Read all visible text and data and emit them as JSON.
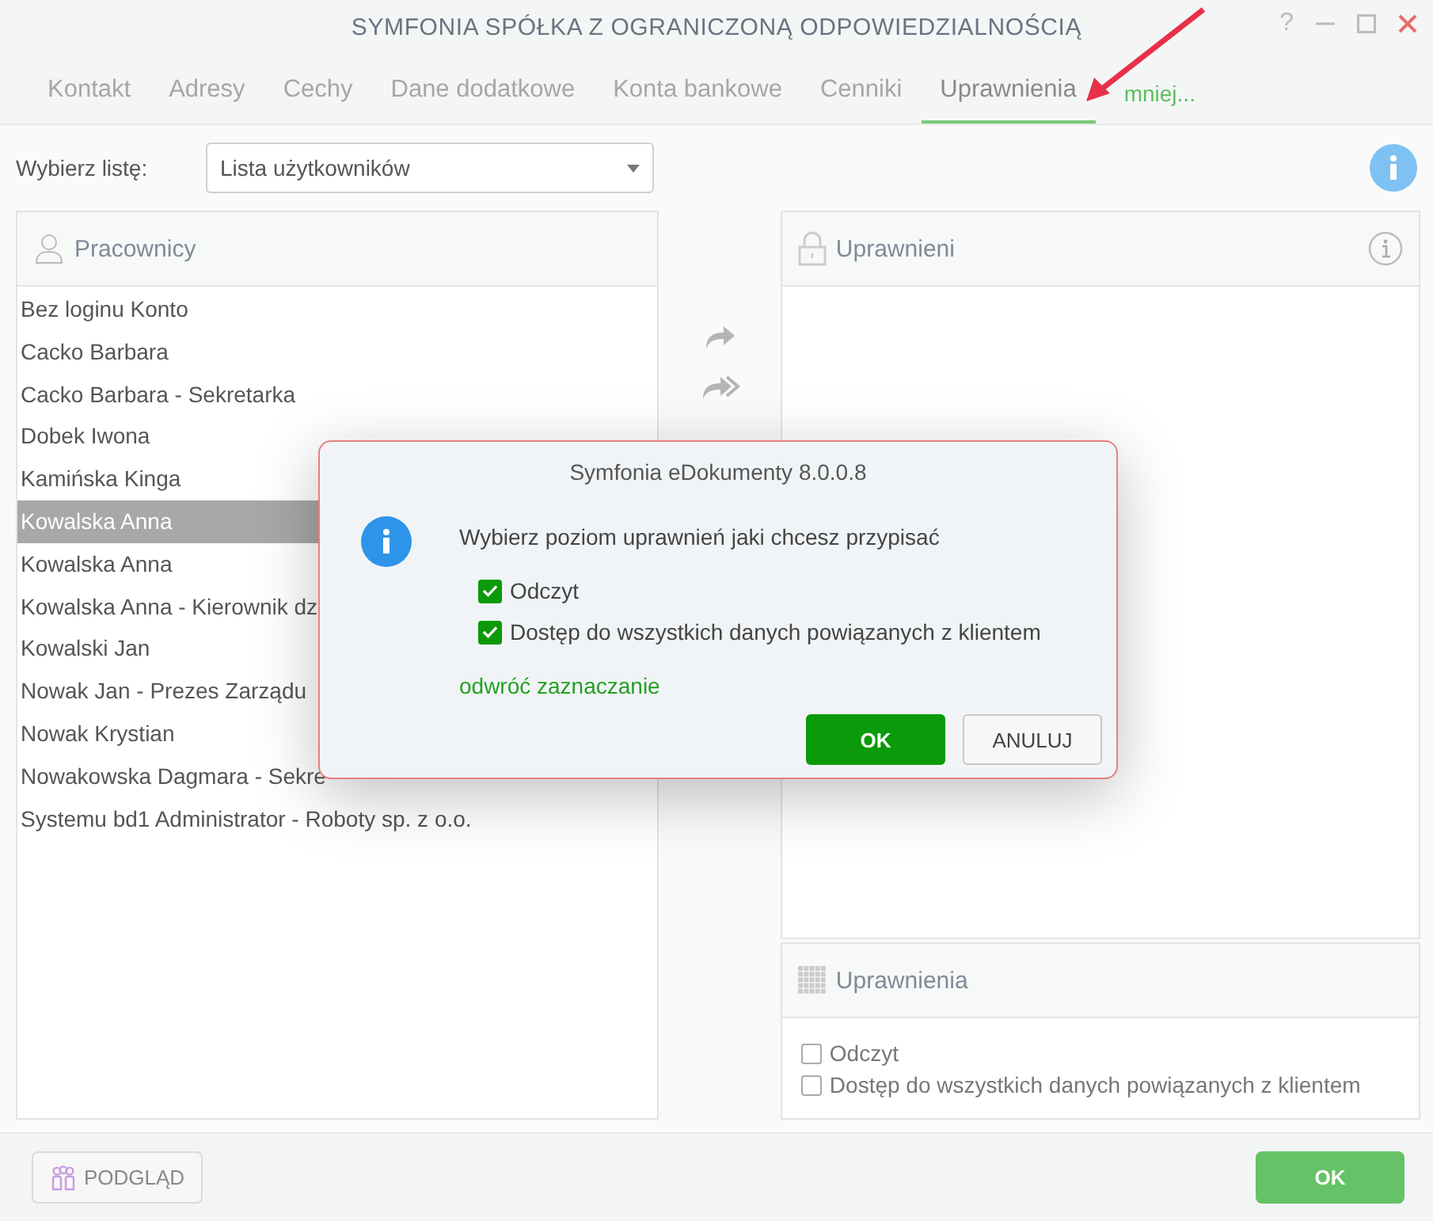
{
  "window": {
    "title": "SYMFONIA SPÓŁKA Z OGRANICZONĄ ODPOWIEDZIALNOŚCIĄ",
    "help": "?"
  },
  "tabs": [
    {
      "label": "Kontakt",
      "selected": false
    },
    {
      "label": "Adresy",
      "selected": false
    },
    {
      "label": "Cechy",
      "selected": false
    },
    {
      "label": "Dane dodatkowe",
      "selected": false
    },
    {
      "label": "Konta bankowe",
      "selected": false
    },
    {
      "label": "Cenniki",
      "selected": false
    },
    {
      "label": "Uprawnienia",
      "selected": true
    }
  ],
  "tabs_more": "mniej...",
  "list_selector": {
    "label": "Wybierz listę:",
    "value": "Lista użytkowników"
  },
  "employees": {
    "title": "Pracownicy",
    "items": [
      {
        "label": "Bez loginu Konto",
        "selected": false
      },
      {
        "label": "Cacko Barbara",
        "selected": false
      },
      {
        "label": "Cacko Barbara - Sekretarka",
        "selected": false
      },
      {
        "label": "Dobek Iwona",
        "selected": false
      },
      {
        "label": "Kamińska Kinga",
        "selected": false
      },
      {
        "label": "Kowalska Anna",
        "selected": true
      },
      {
        "label": "Kowalska Anna",
        "selected": false
      },
      {
        "label": "Kowalska Anna - Kierownik dz",
        "selected": false
      },
      {
        "label": "Kowalski Jan",
        "selected": false
      },
      {
        "label": "Nowak Jan - Prezes Zarządu",
        "selected": false
      },
      {
        "label": "Nowak Krystian",
        "selected": false
      },
      {
        "label": "Nowakowska Dagmara - Sekre",
        "selected": false
      },
      {
        "label": "Systemu bd1 Administrator - Roboty sp. z o.o.",
        "selected": false
      }
    ]
  },
  "authorized": {
    "title": "Uprawnieni"
  },
  "permissions": {
    "title": "Uprawnienia",
    "options": [
      {
        "label": "Odczyt",
        "checked": false
      },
      {
        "label": "Dostęp do wszystkich danych powiązanych z klientem",
        "checked": false
      }
    ]
  },
  "dialog": {
    "title": "Symfonia eDokumenty 8.0.0.8",
    "message": "Wybierz poziom uprawnień jaki chcesz przypisać",
    "options": [
      {
        "label": "Odczyt",
        "checked": true
      },
      {
        "label": "Dostęp do wszystkich danych powiązanych z klientem",
        "checked": true
      }
    ],
    "link": "odwróć zaznaczanie",
    "ok": "OK",
    "cancel": "ANULUJ"
  },
  "footer": {
    "preview": "PODGLĄD",
    "ok": "OK"
  }
}
